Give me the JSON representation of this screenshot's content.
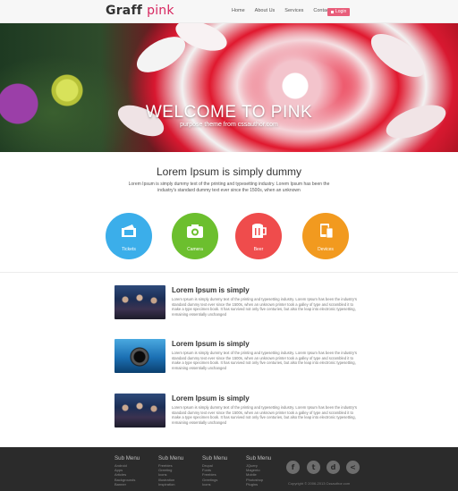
{
  "header": {
    "logo": {
      "main": "Graff",
      "accent": "pink"
    },
    "nav": [
      "Home",
      "About Us",
      "Services",
      "Contact"
    ],
    "login_label": "Login"
  },
  "hero": {
    "title": "WELCOME TO PINK",
    "subtitle": "purpose theme from cssauthor.com"
  },
  "intro": {
    "title": "Lorem Ipsum is simply dummy",
    "text": "Lorem Ipsum is simply dummy text of the printing and typesetting industry. Lorem Ipsum has been the industry's standard dummy text ever since the 1500s, when an unknown"
  },
  "features": [
    {
      "label": "Tickets",
      "icon": "ticket-icon",
      "color": "#3baeea"
    },
    {
      "label": "Camera",
      "icon": "camera-icon",
      "color": "#6cbf2e"
    },
    {
      "label": "Beer",
      "icon": "beer-mug-icon",
      "color": "#ef4c4c"
    },
    {
      "label": "Devices",
      "icon": "devices-icon",
      "color": "#f29a1f"
    }
  ],
  "articles": [
    {
      "title": "Lorem Ipsum is simply",
      "text": "Lorem Ipsum is simply dummy text of the printing and typesetting industry. Lorem Ipsum has been the industry's standard dummy text ever since the 1500s, when an unknown printer took a galley of type and scrambled it to make a type specimen book. It has survived not only five centuries, but also the leap into electronic typesetting, remaining essentially unchanged"
    },
    {
      "title": "Lorem Ipsum is simply",
      "text": "Lorem Ipsum is simply dummy text of the printing and typesetting industry. Lorem Ipsum has been the industry's standard dummy text ever since the 1500s, when an unknown printer took a galley of type and scrambled it to make a type specimen book. It has survived not only five centuries, but also the leap into electronic typesetting, remaining essentially unchanged"
    },
    {
      "title": "Lorem Ipsum is simply",
      "text": "Lorem Ipsum is simply dummy text of the printing and typesetting industry. Lorem Ipsum has been the industry's standard dummy text ever since the 1500s, when an unknown printer took a galley of type and scrambled it to make a type specimen book. It has survived not only five centuries, but also the leap into electronic typesetting, remaining essentially unchanged"
    }
  ],
  "footer": {
    "columns": [
      {
        "heading": "Sub Menu",
        "items": [
          "Android",
          "Apps",
          "Articles",
          "Backgrounds",
          "Banner"
        ]
      },
      {
        "heading": "Sub Menu",
        "items": [
          "Freebies",
          "Greeting",
          "Icons",
          "Illustration",
          "Inspiration"
        ]
      },
      {
        "heading": "Sub Menu",
        "items": [
          "Drupal",
          "Fonts",
          "Freebies",
          "Greetings",
          "Icons"
        ]
      },
      {
        "heading": "Sub Menu",
        "items": [
          "JQuery",
          "Magento",
          "Mobile",
          "Photoshop",
          "Plugins"
        ]
      }
    ],
    "social": [
      "facebook-icon",
      "twitter-icon",
      "dribbble-icon",
      "share-icon"
    ],
    "social_glyphs": [
      "f",
      "t",
      "d",
      "<"
    ],
    "copyright": "Copyright © 2006-2013 Cssauthor.com"
  }
}
